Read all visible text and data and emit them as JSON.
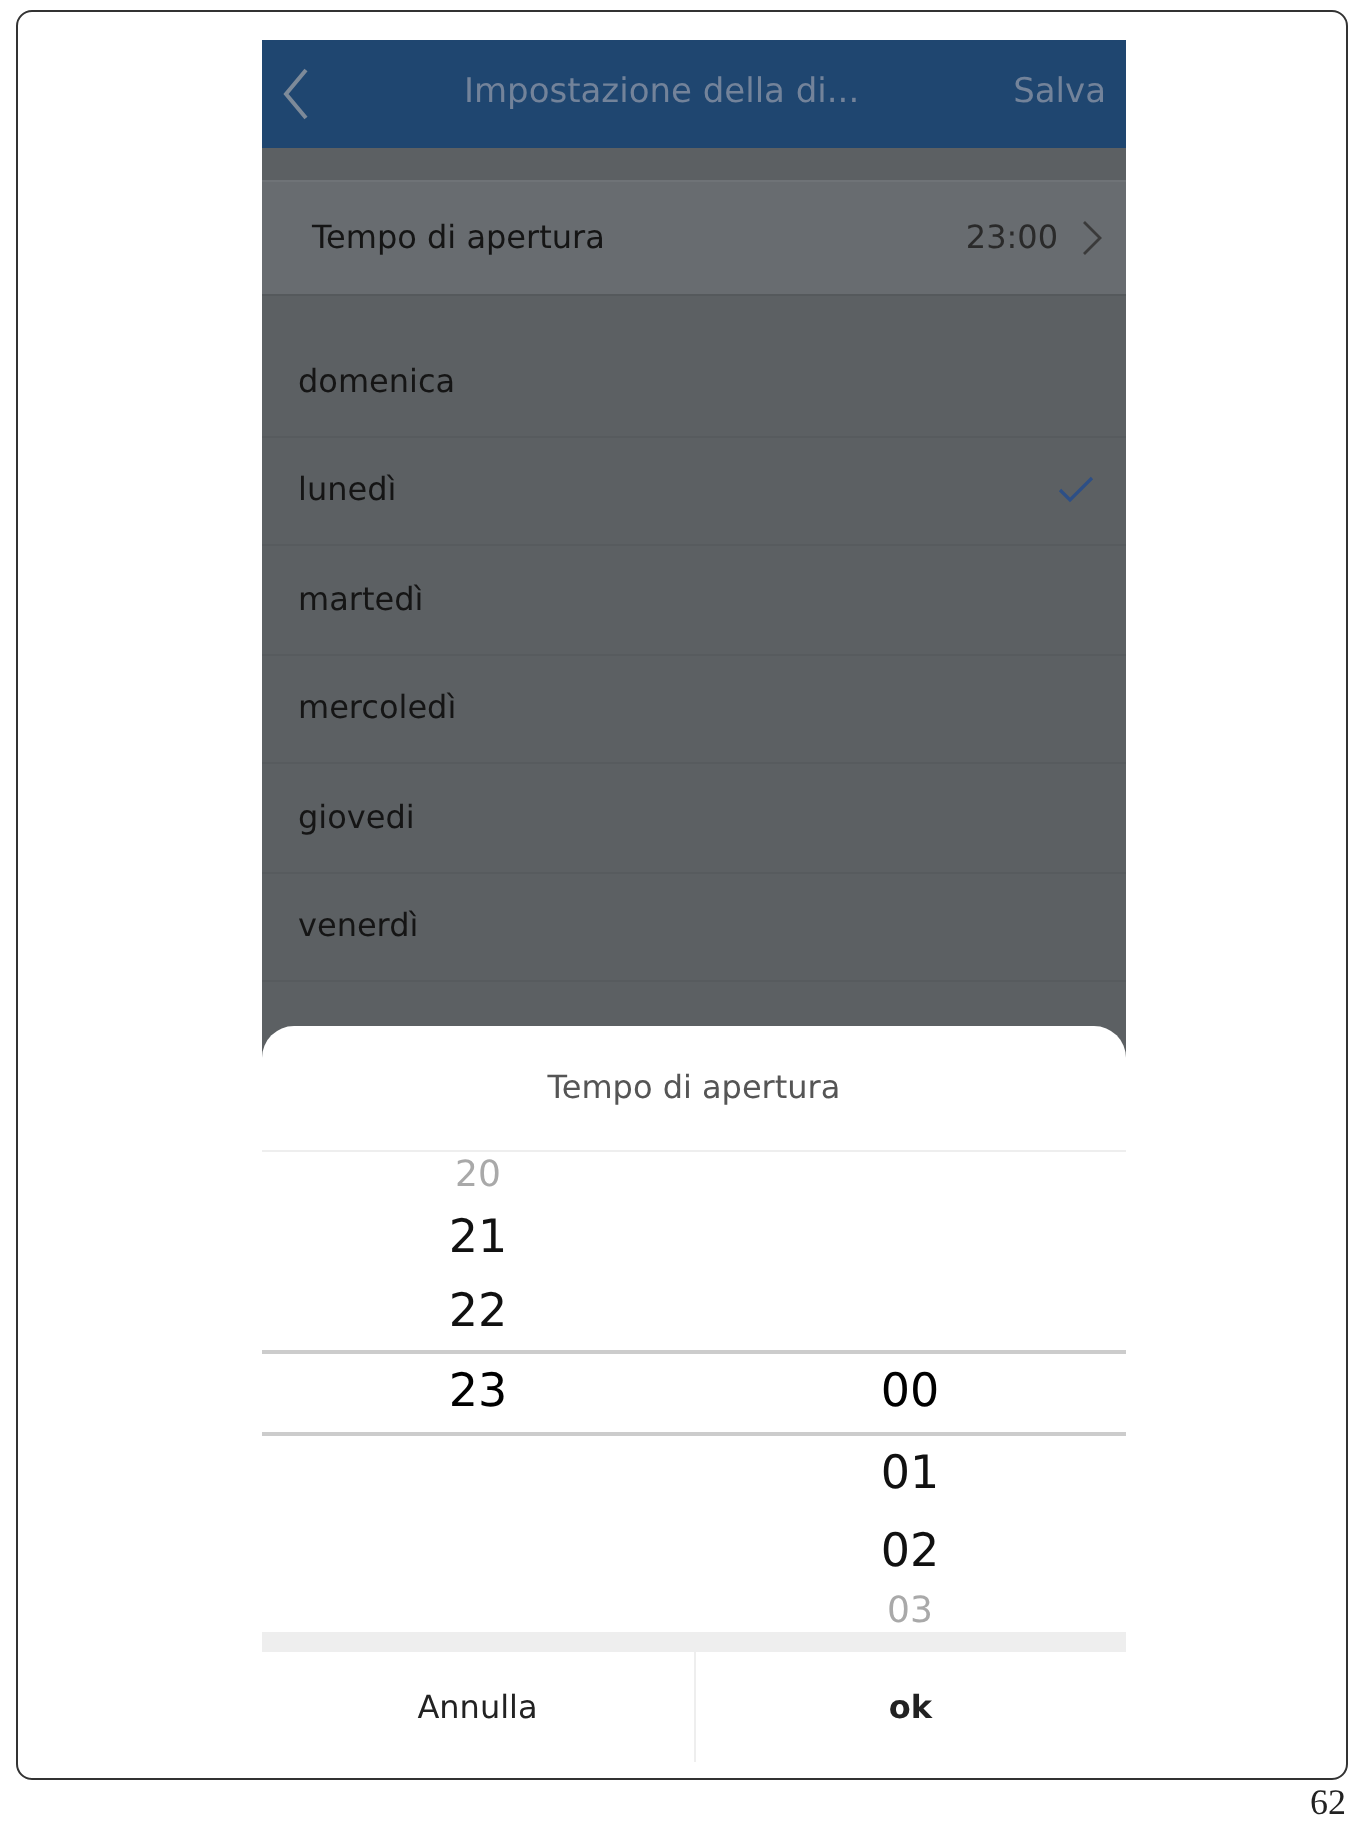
{
  "nav": {
    "title": "Impostazione della di...",
    "action": "Salva"
  },
  "time_row": {
    "label": "Tempo di apertura",
    "value": "23:00"
  },
  "days": [
    {
      "label": "domenica",
      "selected": false
    },
    {
      "label": "lunedì",
      "selected": true
    },
    {
      "label": "martedì",
      "selected": false
    },
    {
      "label": "mercoledì",
      "selected": false
    },
    {
      "label": "giovedi",
      "selected": false
    },
    {
      "label": "venerdì",
      "selected": false
    }
  ],
  "picker": {
    "title": "Tempo di apertura",
    "hours": [
      {
        "label": "20",
        "selected": false
      },
      {
        "label": "21",
        "selected": false
      },
      {
        "label": "22",
        "selected": false
      },
      {
        "label": "23",
        "selected": true
      }
    ],
    "minutes": [
      {
        "label": "00",
        "selected": true
      },
      {
        "label": "01",
        "selected": false
      },
      {
        "label": "02",
        "selected": false
      },
      {
        "label": "03",
        "selected": false
      }
    ],
    "cancel": "Annulla",
    "confirm": "ok"
  },
  "page_number": "62"
}
